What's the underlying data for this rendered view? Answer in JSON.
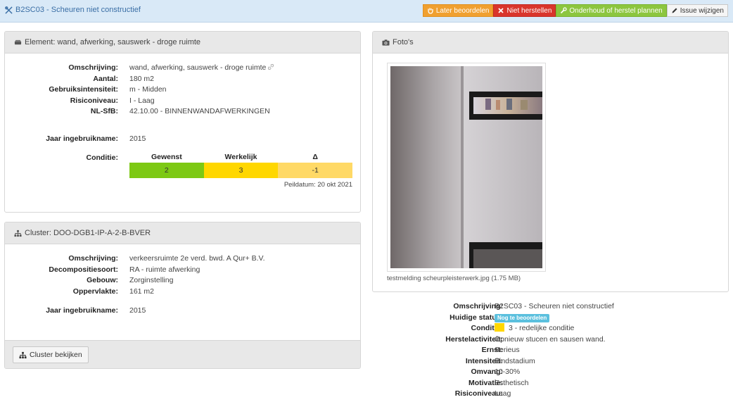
{
  "topbar": {
    "title": "B2SC03 - Scheuren niet constructief",
    "buttons": {
      "later": "Later beoordelen",
      "niet": "Niet herstellen",
      "onderhoud": "Onderhoud of herstel plannen",
      "wijzigen": "Issue wijzigen"
    }
  },
  "element": {
    "header": "Element: wand, afwerking, sauswerk - droge ruimte",
    "rows": [
      {
        "label": "Omschrijving:",
        "value": "wand, afwerking, sauswerk - droge ruimte"
      },
      {
        "label": "Aantal:",
        "value": "180 m2"
      },
      {
        "label": "Gebruiksintensiteit:",
        "value": "m - Midden"
      },
      {
        "label": "Risiconiveau:",
        "value": "I - Laag"
      },
      {
        "label": "NL-SfB:",
        "value": "42.10.00 - BINNENWANDAFWERKINGEN"
      }
    ],
    "year_label": "Jaar ingebruikname:",
    "year_value": "2015",
    "condition_label": "Conditie:",
    "condition": {
      "headers": [
        "Gewenst",
        "Werkelijk",
        "Δ"
      ],
      "values": [
        "2",
        "3",
        "-1"
      ],
      "colors": [
        "#7dc914",
        "#ffd700",
        "#ffd966"
      ]
    },
    "peildatum": "Peildatum: 20 okt 2021"
  },
  "cluster": {
    "header": "Cluster: DOO-DGB1-IP-A-2-B-BVER",
    "rows": [
      {
        "label": "Omschrijving:",
        "value": "verkeersruimte 2e verd. bwd. A Qur+ B.V."
      },
      {
        "label": "Decompositiesoort:",
        "value": "RA - ruimte afwerking"
      },
      {
        "label": "Gebouw:",
        "value": "Zorginstelling"
      },
      {
        "label": "Oppervlakte:",
        "value": "161 m2"
      }
    ],
    "year_label": "Jaar ingebruikname:",
    "year_value": "2015",
    "button": "Cluster bekijken"
  },
  "photos": {
    "header": "Foto's",
    "caption": "testmelding scheurpleisterwerk.jpg (1.75 MB)"
  },
  "issue": {
    "rows": [
      {
        "label": "Omschrijving:",
        "value": "B2SC03 - Scheuren niet constructief"
      },
      {
        "label": "Huidige status:",
        "value": "Nog te beoordelen",
        "type": "badge"
      },
      {
        "label": "Conditie:",
        "value": "3 - redelijke conditie",
        "type": "swatch",
        "color": "#ffd700"
      },
      {
        "label": "Herstelactiviteit:",
        "value": "Opnieuw stucen en sausen wand."
      },
      {
        "label": "Ernst:",
        "value": "Serieus"
      },
      {
        "label": "Intensiteit:",
        "value": "Eindstadium"
      },
      {
        "label": "Omvang:",
        "value": "10-30%"
      },
      {
        "label": "Motivatie:",
        "value": "Esthetisch"
      },
      {
        "label": "Risiconiveau:",
        "value": "Laag"
      }
    ]
  }
}
